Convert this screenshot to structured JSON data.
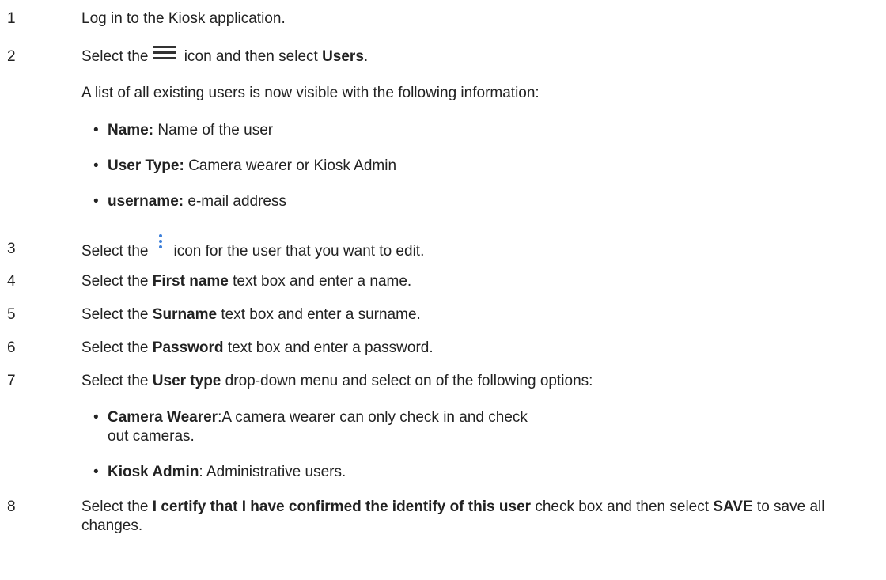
{
  "steps": [
    {
      "num": "1",
      "text": "Log in to the Kiosk application."
    },
    {
      "num": "2",
      "before_icon": "Select the",
      "icon": "hamburger-menu-icon",
      "after_icon": " icon and then select ",
      "bold": "Users",
      "end": "."
    },
    {
      "intro": "A list of all existing users is now visible with the following information:"
    },
    {
      "bullets_step2": [
        {
          "label": "Name:",
          "text": " Name of the user"
        },
        {
          "label": "User Type:",
          "text": " Camera wearer or Kiosk Admin"
        },
        {
          "label": "username:",
          "text": " e-mail address"
        }
      ]
    },
    {
      "num": "3",
      "before_icon": "Select the",
      "icon": "more-vertical-icon",
      "after_icon": "icon for the user that you want to edit."
    },
    {
      "num": "4",
      "pre": "Select the ",
      "bold": "First name",
      "post": " text box and enter a name."
    },
    {
      "num": "5",
      "pre": "Select the ",
      "bold": "Surname",
      "post": " text box and enter a surname."
    },
    {
      "num": "6",
      "pre": "Select the ",
      "bold": "Password",
      "post": " text box and enter a password."
    },
    {
      "num": "7",
      "pre": "Select the ",
      "bold": "User type",
      "post": " drop-down menu and select on of the following options:"
    },
    {
      "bullets_step7": [
        {
          "label": "Camera Wearer",
          "text": ":A camera wearer can only check in and check out cameras."
        },
        {
          "label": "Kiosk Admin",
          "text": ": Administrative users."
        }
      ]
    },
    {
      "num": "8",
      "pre": "Select the ",
      "bold": "I certify that I have confirmed the identify of this user",
      "post": " check box and then select ",
      "bold2": "SAVE",
      "post2": " to save all changes."
    }
  ],
  "colors": {
    "text": "#222222",
    "menu_icon": "#333333",
    "kebab_icon": "#3d7fd9"
  }
}
